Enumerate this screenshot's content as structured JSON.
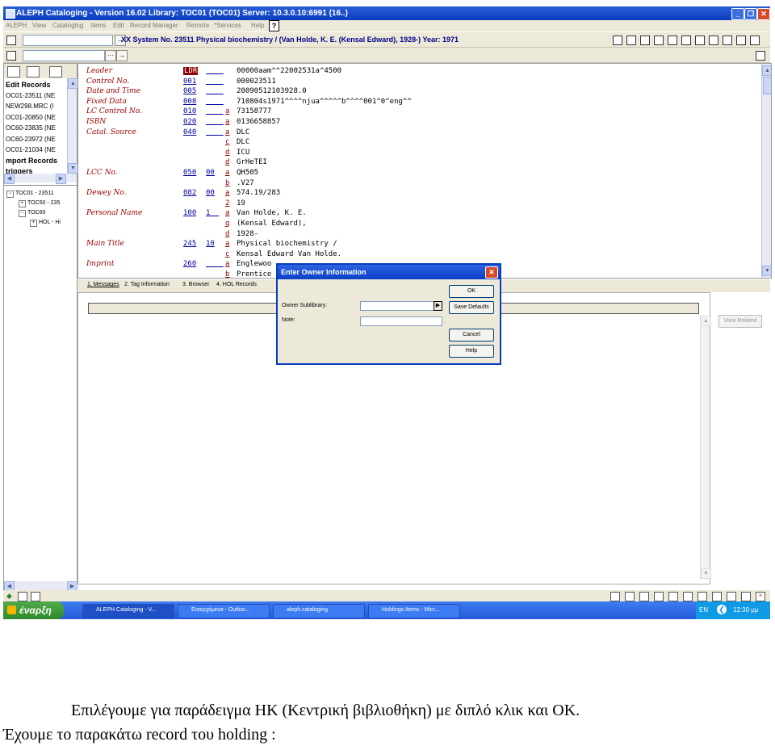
{
  "window": {
    "title": "ALEPH Cataloging - Version 16.02     Library:  TOC01 (TOC01)          Server:  10.3.0.10:6991 (16..)",
    "minimize": "_",
    "maximize": "❐",
    "close": "✕"
  },
  "menu": {
    "items": [
      "ALEPH",
      "View",
      "Cataloging",
      "Items",
      "Edit",
      "Record Manager",
      "Remote",
      "*Services",
      "Help"
    ],
    "help_icon": "?"
  },
  "toolbar": {
    "system_title": "XX System No. 23511 Physical biochemistry / (Van Holde, K. E. (Kensal Edward), 1928-) Year: 1971",
    "arrow": "→",
    "dots": "···"
  },
  "left_panel": {
    "edit_records_title": "Edit Records",
    "records": [
      "OC01-23511 (NE",
      "NEW298.MRC (l",
      "OC01-20850 (NE",
      "OC60-23835 (NE",
      "OC60-23972 (NE",
      "OC01-21034 (NE"
    ],
    "import_title": "mport Records",
    "triggers_title": "triggers",
    "tree": [
      {
        "expander": "−",
        "label": "TOC01 - 23511"
      },
      {
        "expander": "+",
        "label": "TOC50 - 235"
      },
      {
        "expander": "−",
        "label": "TOC60"
      },
      {
        "expander": "+",
        "label": "HOL - Hi"
      }
    ]
  },
  "record": {
    "rows": [
      {
        "label": "Leader",
        "tag": "LDR",
        "ind": "__  _",
        "sub": "",
        "value": "00000aam^^22002531a^4500"
      },
      {
        "label": "Control No.",
        "tag": "001",
        "ind": "__  _",
        "sub": "",
        "value": "000023511"
      },
      {
        "label": "Date and Time",
        "tag": "005",
        "ind": "__  _",
        "sub": "",
        "value": "20090512103928.0"
      },
      {
        "label": "Fixed Data",
        "tag": "008",
        "ind": "__  _",
        "sub": "",
        "value": "710804s1971^^^^njua^^^^^b^^^^001^0^eng^^"
      },
      {
        "label": "LC Control No.",
        "tag": "010",
        "ind": "__  _",
        "sub": "a",
        "value": "73158777"
      },
      {
        "label": "ISBN",
        "tag": "020",
        "ind": "__  _",
        "sub": "a",
        "value": "0136658857"
      },
      {
        "label": "Catal. Source",
        "tag": "040",
        "ind": "__  _",
        "sub": "a",
        "value": "DLC"
      },
      {
        "label": "",
        "tag": "",
        "ind": "",
        "sub": "c",
        "value": "DLC"
      },
      {
        "label": "",
        "tag": "",
        "ind": "",
        "sub": "d",
        "value": "ICU"
      },
      {
        "label": "",
        "tag": "",
        "ind": "",
        "sub": "d",
        "value": "GrHeTEI"
      },
      {
        "label": "LCC No.",
        "tag": "050",
        "ind": "00",
        "sub": "a",
        "value": "QH505"
      },
      {
        "label": "",
        "tag": "",
        "ind": "",
        "sub": "b",
        "value": ".V27"
      },
      {
        "label": "Dewey No.",
        "tag": "082",
        "ind": "00",
        "sub": "a",
        "value": "574.19/283"
      },
      {
        "label": "",
        "tag": "",
        "ind": "",
        "sub": "2",
        "value": "19"
      },
      {
        "label": "Personal Name",
        "tag": "100",
        "ind": "1  _",
        "sub": "a",
        "value": "Van Holde, K. E."
      },
      {
        "label": "",
        "tag": "",
        "ind": "",
        "sub": "q",
        "value": "(Kensal Edward),"
      },
      {
        "label": "",
        "tag": "",
        "ind": "",
        "sub": "d",
        "value": "1928-"
      },
      {
        "label": "Main Title",
        "tag": "245",
        "ind": "10",
        "sub": "a",
        "value": "Physical biochemistry /"
      },
      {
        "label": "",
        "tag": "",
        "ind": "",
        "sub": "c",
        "value": "Kensal Edward Van Holde."
      },
      {
        "label": "Imprint",
        "tag": "260",
        "ind": "__  _",
        "sub": "a",
        "value": "Englewoo"
      },
      {
        "label": "",
        "tag": "",
        "ind": "",
        "sub": "b",
        "value": "Prentice"
      }
    ]
  },
  "bottom_tabs": [
    "1. Messages",
    "2. Tag Information",
    "3. Browser",
    "4. HOL Records"
  ],
  "view_related": "View Related",
  "dialog": {
    "title": "Enter Owner Information",
    "close": "✕",
    "owner_label": "Owner Sublibrary:",
    "note_label": "Note:",
    "owner_value": "",
    "note_value": "",
    "dropdown_arrow": "▶",
    "ok": "OK",
    "save_defaults": "Save Defaults",
    "cancel": "Cancel",
    "help": "Help"
  },
  "taskbar": {
    "start": "έναρξη",
    "tasks": [
      "ALEPH Cataloging - V...",
      "Εισερχόμενα - Outloo...",
      "aleph.cataloging",
      "Holdings.Items - Micr..."
    ],
    "lang": "EN",
    "clock": "12:30 μμ"
  },
  "caption": {
    "line1": "Επιλέγουμε για παράδειγμα ΗΚ (Κεντρική βιβλιοθήκη) με διπλό κλικ και ΟΚ.",
    "line2": "Έχουμε το παρακάτω record του holding :"
  }
}
